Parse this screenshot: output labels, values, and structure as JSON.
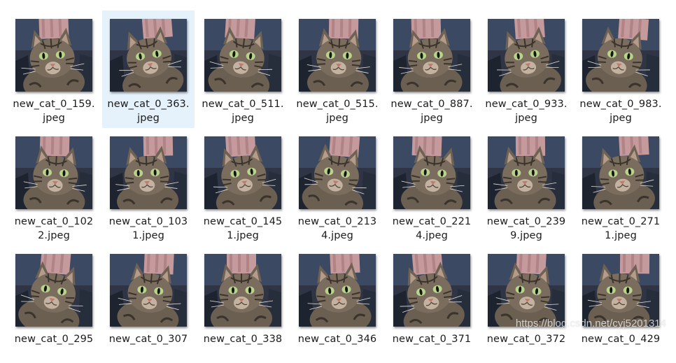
{
  "files": [
    {
      "line1": "new_cat_0_159.",
      "line2": "jpeg",
      "selected": false,
      "thumbnail": "cat-photo"
    },
    {
      "line1": "new_cat_0_363.",
      "line2": "jpeg",
      "selected": true,
      "thumbnail": "cat-photo"
    },
    {
      "line1": "new_cat_0_511.",
      "line2": "jpeg",
      "selected": false,
      "thumbnail": "cat-photo"
    },
    {
      "line1": "new_cat_0_515.",
      "line2": "jpeg",
      "selected": false,
      "thumbnail": "cat-photo"
    },
    {
      "line1": "new_cat_0_887.",
      "line2": "jpeg",
      "selected": false,
      "thumbnail": "cat-photo"
    },
    {
      "line1": "new_cat_0_933.",
      "line2": "jpeg",
      "selected": false,
      "thumbnail": "cat-photo"
    },
    {
      "line1": "new_cat_0_983.",
      "line2": "jpeg",
      "selected": false,
      "thumbnail": "cat-photo"
    },
    {
      "line1": "new_cat_0_102",
      "line2": "2.jpeg",
      "selected": false,
      "thumbnail": "cat-photo"
    },
    {
      "line1": "new_cat_0_103",
      "line2": "1.jpeg",
      "selected": false,
      "thumbnail": "cat-photo"
    },
    {
      "line1": "new_cat_0_145",
      "line2": "1.jpeg",
      "selected": false,
      "thumbnail": "cat-photo"
    },
    {
      "line1": "new_cat_0_213",
      "line2": "4.jpeg",
      "selected": false,
      "thumbnail": "cat-photo"
    },
    {
      "line1": "new_cat_0_221",
      "line2": "4.jpeg",
      "selected": false,
      "thumbnail": "cat-photo"
    },
    {
      "line1": "new_cat_0_239",
      "line2": "9.jpeg",
      "selected": false,
      "thumbnail": "cat-photo"
    },
    {
      "line1": "new_cat_0_271",
      "line2": "1.jpeg",
      "selected": false,
      "thumbnail": "cat-photo"
    },
    {
      "line1": "new_cat_0_295",
      "line2": "",
      "selected": false,
      "thumbnail": "cat-photo"
    },
    {
      "line1": "new_cat_0_307",
      "line2": "",
      "selected": false,
      "thumbnail": "cat-photo"
    },
    {
      "line1": "new_cat_0_338",
      "line2": "",
      "selected": false,
      "thumbnail": "cat-photo"
    },
    {
      "line1": "new_cat_0_346",
      "line2": "",
      "selected": false,
      "thumbnail": "cat-photo"
    },
    {
      "line1": "new_cat_0_371",
      "line2": "",
      "selected": false,
      "thumbnail": "cat-photo"
    },
    {
      "line1": "new_cat_0_372",
      "line2": "",
      "selected": false,
      "thumbnail": "cat-photo"
    },
    {
      "line1": "new_cat_0_429",
      "line2": "",
      "selected": false,
      "thumbnail": "cat-photo"
    }
  ],
  "watermark": "https://blog.csdn.net/cyj5201314",
  "colors": {
    "selection": "#e5f1fb",
    "label_text": "#1b1b1b"
  }
}
